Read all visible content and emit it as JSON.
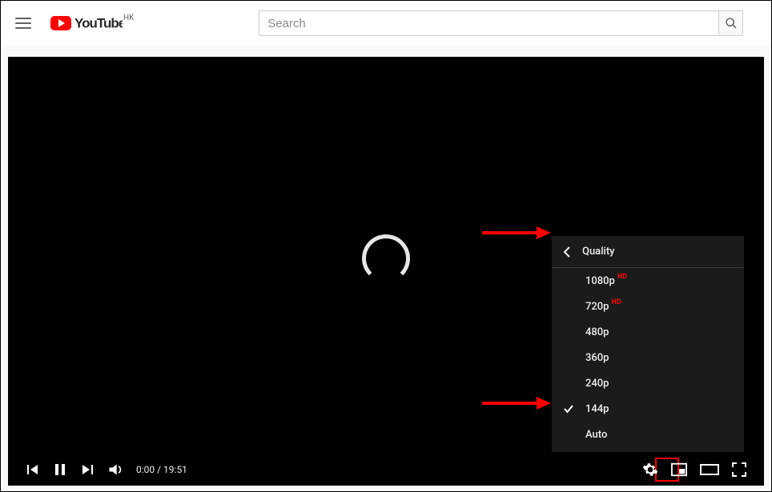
{
  "header": {
    "logo_text": "YouTube",
    "region": "HK",
    "search_placeholder": "Search"
  },
  "player": {
    "time_current": "0:00",
    "time_separator": " / ",
    "time_total": "19:51"
  },
  "quality_menu": {
    "title": "Quality",
    "selected": "144p",
    "items": [
      {
        "label": "1080p",
        "hd": true
      },
      {
        "label": "720p",
        "hd": true
      },
      {
        "label": "480p",
        "hd": false
      },
      {
        "label": "360p",
        "hd": false
      },
      {
        "label": "240p",
        "hd": false
      },
      {
        "label": "144p",
        "hd": false
      },
      {
        "label": "Auto",
        "hd": false
      }
    ]
  }
}
